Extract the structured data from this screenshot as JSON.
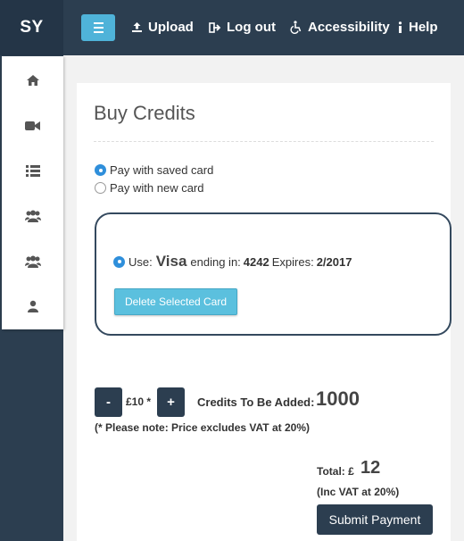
{
  "brand": "SY",
  "nav": {
    "upload": "Upload",
    "logout": "Log out",
    "accessibility": "Accessibility",
    "help": "Help"
  },
  "sidebar": {
    "items": [
      {
        "icon": "home-icon"
      },
      {
        "icon": "video-camera-icon"
      },
      {
        "icon": "list-icon"
      },
      {
        "icon": "group-icon"
      },
      {
        "icon": "group-icon"
      },
      {
        "icon": "user-icon"
      }
    ]
  },
  "page": {
    "title": "Buy Credits",
    "options": {
      "saved": "Pay with saved card",
      "new": "Pay with new card",
      "selected": "saved"
    },
    "card": {
      "use_label": "Use:",
      "brand": "Visa",
      "ending_label": "ending in:",
      "last4": "4242",
      "expires_label": "Expires:",
      "expiry": "2/2017",
      "delete_label": "Delete Selected Card"
    },
    "credits": {
      "minus_label": "-",
      "plus_label": "+",
      "price_label": "£10 *",
      "credits_label": "Credits To Be Added:",
      "credits_value": "1000",
      "vat_note": "(* Please note: Price excludes VAT at 20%)"
    },
    "total": {
      "label": "Total: £",
      "value": "12",
      "inc_vat": "(Inc VAT at 20%)",
      "submit_label": "Submit Payment"
    }
  },
  "colors": {
    "topbar": "#2c3e50",
    "accent": "#5bc0de",
    "radio_checked": "#2f8fdb"
  }
}
